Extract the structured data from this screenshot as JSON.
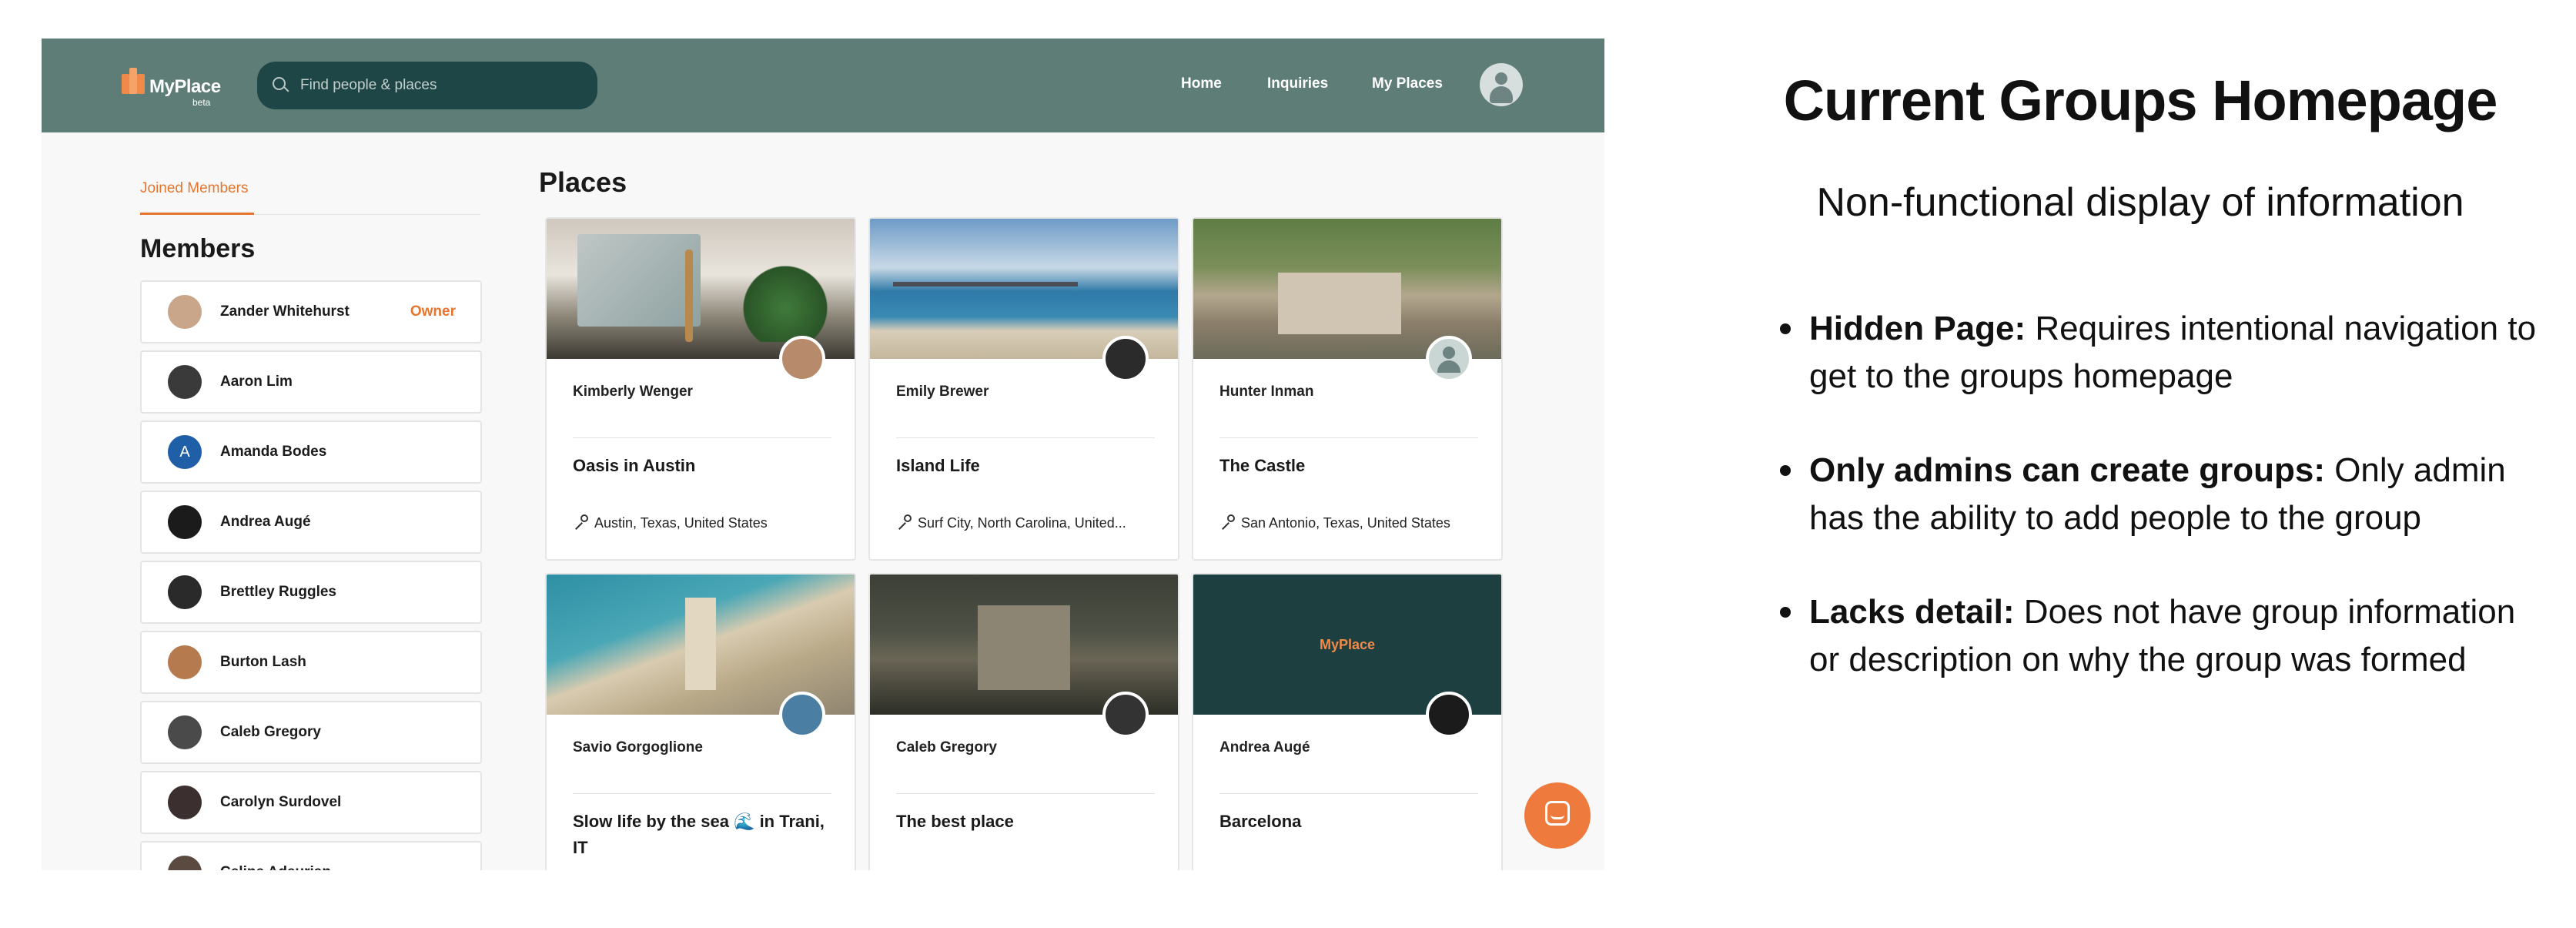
{
  "app": {
    "logo_text": "MyPlace",
    "logo_badge": "beta",
    "search_placeholder": "Find people & places",
    "nav": [
      "Home",
      "Inquiries",
      "My Places"
    ]
  },
  "sidebar": {
    "tab_label": "Joined Members",
    "members_title": "Members",
    "members": [
      {
        "name": "Zander Whitehurst",
        "role": "Owner",
        "avatar_color": "#c9a58a"
      },
      {
        "name": "Aaron Lim",
        "role": "",
        "avatar_color": "#3a3a3a"
      },
      {
        "name": "Amanda Bodes",
        "role": "",
        "avatar_color": "#1e5fa8",
        "initial": "A"
      },
      {
        "name": "Andrea Augé",
        "role": "",
        "avatar_color": "#1b1b1b"
      },
      {
        "name": "Brettley Ruggles",
        "role": "",
        "avatar_color": "#2a2a2a"
      },
      {
        "name": "Burton Lash",
        "role": "",
        "avatar_color": "#b57a4e"
      },
      {
        "name": "Caleb Gregory",
        "role": "",
        "avatar_color": "#4a4a4a"
      },
      {
        "name": "Carolyn Surdovel",
        "role": "",
        "avatar_color": "#3b2f2f"
      },
      {
        "name": "Celine Adeurian",
        "role": "",
        "avatar_color": "#5a4a40"
      }
    ]
  },
  "places": {
    "title": "Places",
    "cards": [
      {
        "person": "Kimberly Wenger",
        "title": "Oasis in Austin",
        "location": "Austin, Texas, United States"
      },
      {
        "person": "Emily Brewer",
        "title": "Island Life",
        "location": "Surf City, North Carolina, United..."
      },
      {
        "person": "Hunter Inman",
        "title": "The Castle",
        "location": "San Antonio, Texas, United States"
      },
      {
        "person": "Savio Gorgoglione",
        "title": "Slow life by the sea 🌊 in Trani, IT",
        "location": ""
      },
      {
        "person": "Caleb Gregory",
        "title": "The best place",
        "location": ""
      },
      {
        "person": "Andrea Augé",
        "title": "Barcelona",
        "location": ""
      }
    ],
    "placeholder_logo": "MyPlace"
  },
  "panel": {
    "title": "Current Groups Homepage",
    "subtitle": "Non-functional display of information",
    "bullets": [
      {
        "label": "Hidden Page:",
        "text": " Requires  intentional navigation to get to the groups homepage"
      },
      {
        "label": "Only admins  can create groups:",
        "text": " Only admin has the ability to add people to the group"
      },
      {
        "label": "Lacks detail:",
        "text": " Does not have group information or description  on why the group was formed"
      }
    ]
  },
  "colors": {
    "navbar": "#5e7d76",
    "search_bg": "#1f4646",
    "accent": "#e6762f",
    "chat_bubble": "#ee7a3d"
  }
}
